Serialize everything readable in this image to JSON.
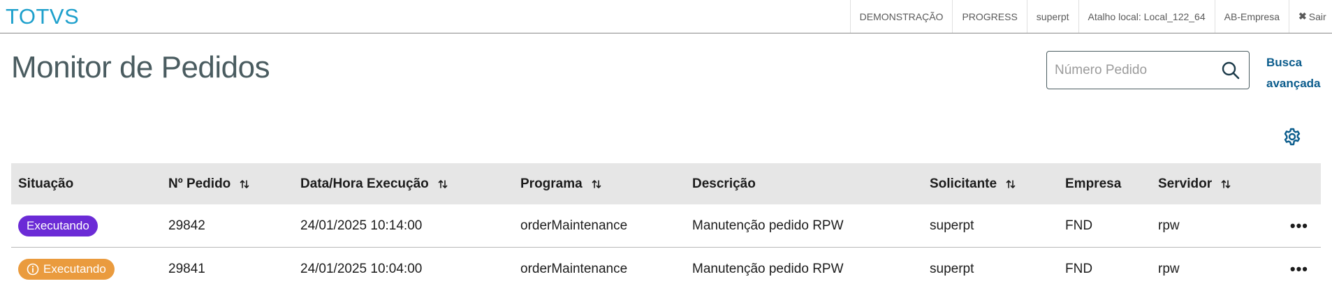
{
  "app": {
    "logo": "TOTVS"
  },
  "topmenu": {
    "items": [
      "DEMONSTRAÇÃO",
      "PROGRESS",
      "superpt",
      "Atalho local: Local_122_64",
      "AB-Empresa"
    ],
    "exit_label": "Sair"
  },
  "page": {
    "title": "Monitor de Pedidos"
  },
  "search": {
    "placeholder": "Número Pedido",
    "value": "",
    "advanced_line1": "Busca",
    "advanced_line2": "avançada"
  },
  "colors": {
    "brand": "#1ea0cc",
    "link": "#0b5c8c",
    "running_badge": "#6b2bd6",
    "warning_badge": "#ea9b3e",
    "header_bg": "#e6e6e6"
  },
  "table": {
    "columns": [
      "Situação",
      "Nº Pedido",
      "Data/Hora Execução",
      "Programa",
      "Descrição",
      "Solicitante",
      "Empresa",
      "Servidor"
    ],
    "sortable": [
      false,
      true,
      true,
      true,
      false,
      true,
      false,
      true
    ],
    "rows": [
      {
        "status": "Executando",
        "status_icon": "",
        "order": "29842",
        "datetime": "24/01/2025 10:14:00",
        "program": "orderMaintenance",
        "description": "Manutenção pedido RPW",
        "requester": "superpt",
        "company": "FND",
        "server": "rpw",
        "actions_icon": "more-horizontal-icon"
      },
      {
        "status": "Executando",
        "status_icon": "info-circle-icon",
        "order": "29841",
        "datetime": "24/01/2025 10:04:00",
        "program": "orderMaintenance",
        "description": "Manutenção pedido RPW",
        "requester": "superpt",
        "company": "FND",
        "server": "rpw",
        "actions_icon": "more-horizontal-icon"
      }
    ]
  }
}
